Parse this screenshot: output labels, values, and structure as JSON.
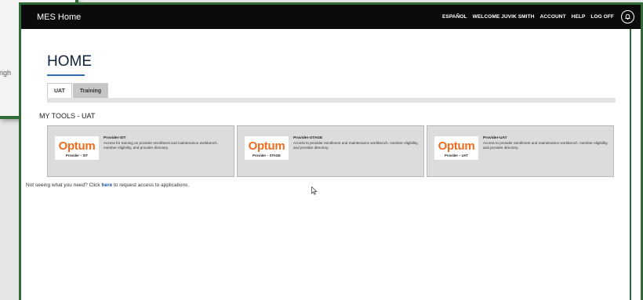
{
  "background_window": {
    "partial_text": "righ"
  },
  "header": {
    "app_title": "MES Home",
    "nav": [
      "ESPAÑOL",
      "WELCOME JUVIK SMITH",
      "ACCOUNT",
      "HELP",
      "LOG OFF"
    ],
    "bell_icon": "bell-icon"
  },
  "page": {
    "heading": "HOME",
    "tabs": [
      {
        "label": "UAT",
        "active": true
      },
      {
        "label": "Training",
        "active": false
      }
    ],
    "section_title": "MY TOOLS - UAT"
  },
  "tools": [
    {
      "logo_text": "Optum",
      "logo_sub": "Provider – SIT",
      "name": "Provider-SIT",
      "description": "Access for training on provider enrollment and maintenance workbench, member eligibility, and provider directory."
    },
    {
      "logo_text": "Optum",
      "logo_sub": "Provider – STAGE",
      "name": "Provider-STAGE",
      "description": "Access to provider enrollment and maintenance workbench, member eligibility, and provider directory."
    },
    {
      "logo_text": "Optum",
      "logo_sub": "Provider – UAT",
      "name": "Provider-UAT",
      "description": "Access to provider enrollment and maintenance workbench, member eligibility, and provider directory."
    }
  ],
  "help": {
    "prefix": "Not seeing what you need? Click ",
    "link": "here",
    "suffix": " to request access to applications."
  },
  "colors": {
    "topbar": "#0b0b0b",
    "frame_border": "#2e6b37",
    "optum_orange": "#ef6c1e",
    "link": "#1a4e9c"
  }
}
